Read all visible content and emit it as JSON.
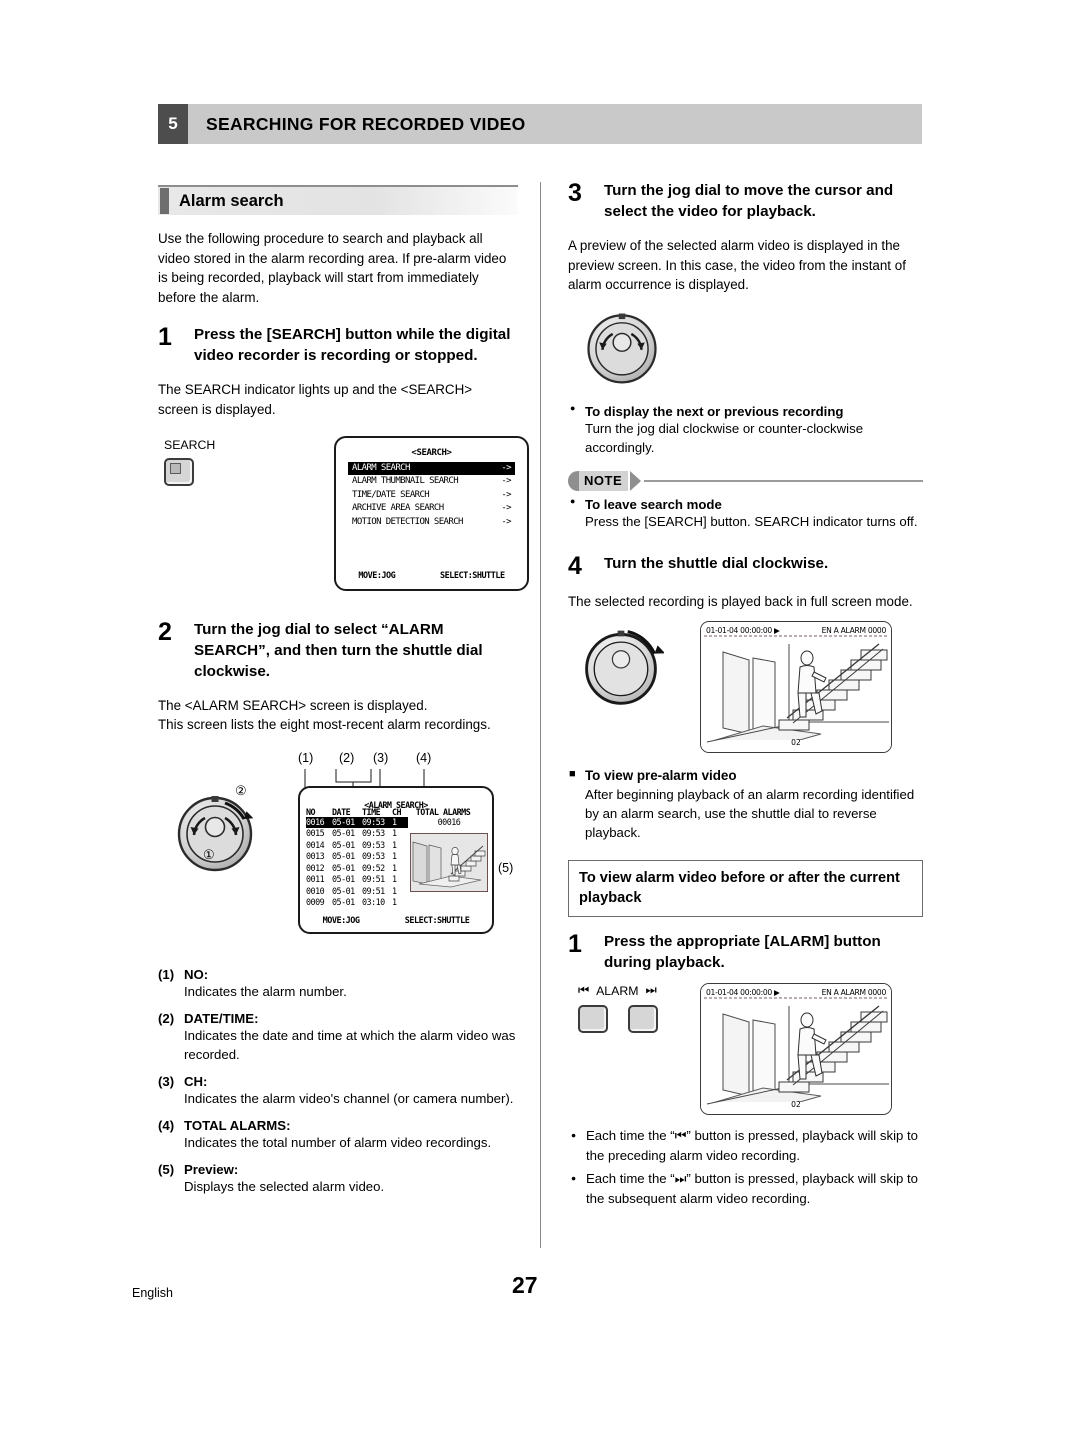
{
  "header": {
    "chapter_number": "5",
    "chapter_title": "SEARCHING FOR RECORDED VIDEO"
  },
  "left_column": {
    "section_title": "Alarm search",
    "intro": "Use the following procedure to search and playback all video stored in the alarm recording area. If pre-alarm video is being recorded, playback will start from immediately before the alarm.",
    "step1": {
      "number": "1",
      "text": "Press the [SEARCH] button while the digital video recorder is recording or stopped.",
      "body": "The SEARCH indicator lights up and the <SEARCH> screen is displayed.",
      "button_label": "SEARCH"
    },
    "search_screen": {
      "title": "<SEARCH>",
      "items": [
        {
          "label": "ALARM SEARCH",
          "arrow": "->",
          "selected": true
        },
        {
          "label": "ALARM THUMBNAIL SEARCH",
          "arrow": "->",
          "selected": false
        },
        {
          "label": "TIME/DATE SEARCH",
          "arrow": "->",
          "selected": false
        },
        {
          "label": "ARCHIVE AREA SEARCH",
          "arrow": "->",
          "selected": false
        },
        {
          "label": "MOTION DETECTION SEARCH",
          "arrow": "->",
          "selected": false
        }
      ],
      "footer_left": "MOVE:JOG",
      "footer_right": "SELECT:SHUTTLE"
    },
    "step2": {
      "number": "2",
      "text": "Turn the jog dial to select “ALARM SEARCH”, and then turn the shuttle dial clockwise.",
      "body_line1": "The <ALARM SEARCH> screen is displayed.",
      "body_line2": "This screen lists the eight most-recent alarm recordings."
    },
    "jog_callouts": {
      "one": "①",
      "two": "②"
    },
    "alarm_callouts": [
      "(1)",
      "(2)",
      "(3)",
      "(4)",
      "(5)"
    ],
    "alarm_search_screen": {
      "title": "<ALARM SEARCH>",
      "columns": [
        "NO",
        "DATE",
        "TIME",
        "CH"
      ],
      "total_label": "TOTAL ALARMS",
      "total_value": "00016",
      "rows": [
        {
          "no": "0016",
          "date": "05-01",
          "time": "09:53",
          "ch": "1",
          "selected": true
        },
        {
          "no": "0015",
          "date": "05-01",
          "time": "09:53",
          "ch": "1",
          "selected": false
        },
        {
          "no": "0014",
          "date": "05-01",
          "time": "09:53",
          "ch": "1",
          "selected": false
        },
        {
          "no": "0013",
          "date": "05-01",
          "time": "09:53",
          "ch": "1",
          "selected": false
        },
        {
          "no": "0012",
          "date": "05-01",
          "time": "09:52",
          "ch": "1",
          "selected": false
        },
        {
          "no": "0011",
          "date": "05-01",
          "time": "09:51",
          "ch": "1",
          "selected": false
        },
        {
          "no": "0010",
          "date": "05-01",
          "time": "09:51",
          "ch": "1",
          "selected": false
        },
        {
          "no": "0009",
          "date": "05-01",
          "time": "03:10",
          "ch": "1",
          "selected": false
        }
      ],
      "footer_left": "MOVE:JOG",
      "footer_right": "SELECT:SHUTTLE"
    },
    "definitions": [
      {
        "num": "(1)",
        "term": "NO:",
        "desc": "Indicates the alarm number."
      },
      {
        "num": "(2)",
        "term": "DATE/TIME:",
        "desc": "Indicates the date and time at which the alarm video was recorded."
      },
      {
        "num": "(3)",
        "term": "CH:",
        "desc": "Indicates the alarm video's channel (or camera number)."
      },
      {
        "num": "(4)",
        "term": "TOTAL ALARMS:",
        "desc": "Indicates the total number of alarm video recordings."
      },
      {
        "num": "(5)",
        "term": "Preview:",
        "desc": "Displays the selected alarm video."
      }
    ]
  },
  "right_column": {
    "step3": {
      "number": "3",
      "text": "Turn the jog dial to move the cursor and select the video for playback.",
      "body": "A preview of the selected alarm video is displayed in the preview screen. In this case, the video from the instant of alarm occurrence is displayed."
    },
    "bullet_next_prev": {
      "head": "To display the next or previous recording",
      "body": "Turn the jog dial clockwise or counter-clockwise accordingly."
    },
    "note": {
      "label": "NOTE",
      "head": "To leave search mode",
      "body": "Press the [SEARCH] button. SEARCH indicator turns off."
    },
    "step4": {
      "number": "4",
      "text": "Turn the shuttle dial clockwise.",
      "body": "The selected recording is played back in full screen mode."
    },
    "playback_screen_1": {
      "timestamp": "01-01-04 00:00:00",
      "play_icon": "▶",
      "status": "EN A ALARM 0000",
      "channel": "02"
    },
    "prealarm": {
      "head": "To view pre-alarm video",
      "body": "After beginning playback of an alarm recording identified by an alarm search, use the shuttle dial to reverse playback."
    },
    "framed_heading": "To view alarm video before or after the current playback",
    "step5": {
      "number": "1",
      "text": "Press the appropriate [ALARM] button during playback.",
      "button_label": "ALARM",
      "prev_icon": "⏮",
      "next_icon": "⏭"
    },
    "playback_screen_2": {
      "timestamp": "01-01-04 00:00:00",
      "play_icon": "▶",
      "status": "EN A ALARM 0000",
      "channel": "02"
    },
    "final_bullets": [
      {
        "pre": "Each time the “",
        "icon": "⏮",
        "post": "” button is pressed, playback will skip to the preceding alarm video recording."
      },
      {
        "pre": "Each time the “",
        "icon": "⏭",
        "post": "” button is pressed, playback will skip to the subsequent alarm video recording."
      }
    ]
  },
  "footer": {
    "language": "English",
    "page_number": "27"
  }
}
